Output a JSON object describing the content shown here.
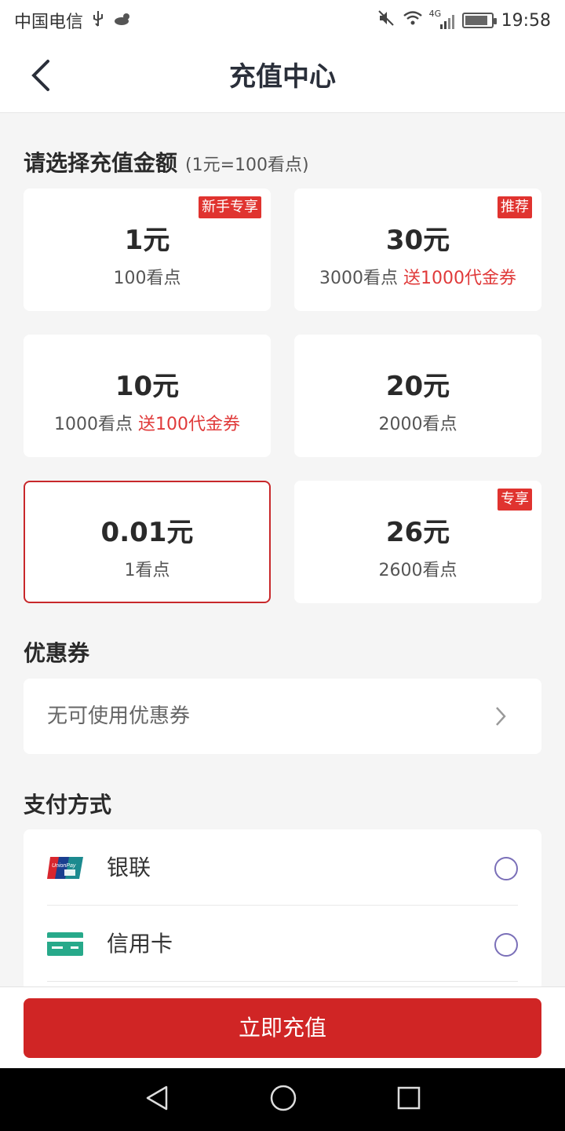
{
  "status_bar": {
    "carrier": "中国电信",
    "usb_icon": "usb-icon",
    "weather_icon": "weather-icon",
    "network": "4G",
    "time": "19:58"
  },
  "header": {
    "title": "充值中心",
    "back_icon": "back-arrow-icon"
  },
  "amount_section": {
    "title": "请选择充值金额",
    "rate_note": "(1元=100看点)",
    "options": [
      {
        "price": "1元",
        "points": "100看点",
        "bonus": "",
        "badge": "新手专享",
        "selected": false
      },
      {
        "price": "30元",
        "points": "3000看点",
        "bonus": "送1000代金券",
        "badge": "推荐",
        "selected": false
      },
      {
        "price": "10元",
        "points": "1000看点",
        "bonus": "送100代金券",
        "badge": "",
        "selected": false
      },
      {
        "price": "20元",
        "points": "2000看点",
        "bonus": "",
        "badge": "",
        "selected": false
      },
      {
        "price": "0.01元",
        "points": "1看点",
        "bonus": "",
        "badge": "",
        "selected": true
      },
      {
        "price": "26元",
        "points": "2600看点",
        "bonus": "",
        "badge": "专享",
        "selected": false
      }
    ]
  },
  "coupon_section": {
    "title": "优惠券",
    "value": "无可使用优惠券"
  },
  "payment_section": {
    "title": "支付方式",
    "methods": [
      {
        "label": "银联",
        "icon": "unionpay-icon",
        "selected": false
      },
      {
        "label": "信用卡",
        "icon": "credit-card-icon",
        "selected": false
      }
    ]
  },
  "action": {
    "button_label": "立即充值"
  },
  "colors": {
    "accent": "#d02525",
    "badge": "#e0332f",
    "bonus_text": "#e03a3a",
    "radio": "#7a6fb8"
  }
}
